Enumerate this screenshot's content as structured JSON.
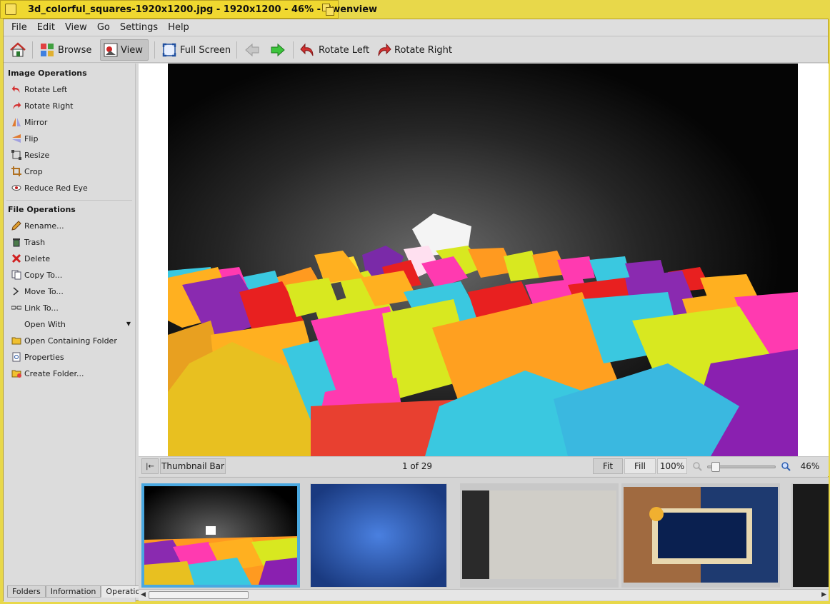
{
  "window": {
    "title": "3d_colorful_squares-1920x1200.jpg - 1920x1200 - 46%  - Gwenview"
  },
  "menu": [
    "File",
    "Edit",
    "View",
    "Go",
    "Settings",
    "Help"
  ],
  "toolbar": {
    "browse": "Browse",
    "view": "View",
    "fullscreen": "Full Screen",
    "rotate_left": "Rotate Left",
    "rotate_right": "Rotate Right"
  },
  "sidebar": {
    "image_ops_title": "Image Operations",
    "image_ops": [
      "Rotate Left",
      "Rotate Right",
      "Mirror",
      "Flip",
      "Resize",
      "Crop",
      "Reduce Red Eye"
    ],
    "file_ops_title": "File Operations",
    "file_ops": [
      "Rename...",
      "Trash",
      "Delete",
      "Copy To...",
      "Move To...",
      "Link To...",
      "Open With",
      "Open Containing Folder",
      "Properties",
      "Create Folder..."
    ],
    "tabs": [
      "Folders",
      "Information",
      "Operations"
    ],
    "active_tab": "Operations"
  },
  "statusbar": {
    "thumbnail_bar": "Thumbnail Bar",
    "position": "1 of 29",
    "fit": "Fit",
    "fill": "Fill",
    "hundred": "100%",
    "zoom": "46%",
    "zoom_level": 0.46
  },
  "colors": {
    "accent": "#4aa8e0",
    "frame": "#e8d84a"
  }
}
